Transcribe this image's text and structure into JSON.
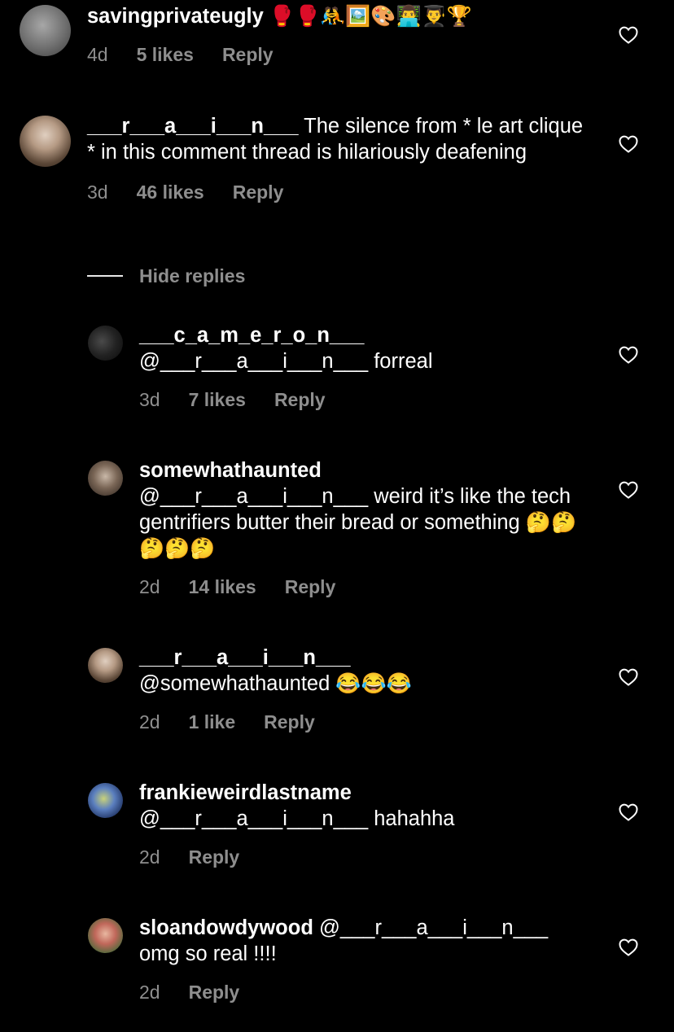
{
  "comments": [
    {
      "username": "savingprivateugly",
      "username_emoji": "🥊🥊🤼🖼️🎨👨‍💻👨‍🎓🏆",
      "text": "",
      "time": "4d",
      "likes": "5 likes",
      "reply_label": "Reply",
      "avatar_colors": [
        "#9a9a9a",
        "#5a5a5a"
      ]
    },
    {
      "username": "___r___a___i___n___",
      "text": "The silence from * le art clique * in this comment thread is hilariously deafening",
      "time": "3d",
      "likes": "46 likes",
      "reply_label": "Reply",
      "avatar_colors": [
        "#c8b9a4",
        "#6b5a4a"
      ]
    }
  ],
  "hide_replies_label": "Hide replies",
  "replies": [
    {
      "username": "___c_a_m_e_r_o_n___",
      "text": "@___r___a___i___n___ forreal",
      "emoji": "",
      "time": "3d",
      "likes": "7 likes",
      "reply_label": "Reply",
      "avatar_colors": [
        "#3a3a3a",
        "#0c0c0c"
      ]
    },
    {
      "username": "somewhathaunted",
      "text": "@___r___a___i___n___ weird it’s like the tech gentrifiers butter their bread or something",
      "emoji": "🤔🤔🤔🤔🤔",
      "time": "2d",
      "likes": "14 likes",
      "reply_label": "Reply",
      "avatar_colors": [
        "#a8988a",
        "#3b2f28"
      ]
    },
    {
      "username": "___r___a___i___n___",
      "text": "@somewhathaunted",
      "emoji": "😂😂😂",
      "time": "2d",
      "likes": "1 like",
      "reply_label": "Reply",
      "avatar_colors": [
        "#c8b9a4",
        "#6b5a4a"
      ]
    },
    {
      "username": "frankieweirdlastname",
      "text": "@___r___a___i___n___ hahahha",
      "emoji": "",
      "time": "2d",
      "likes": "",
      "reply_label": "Reply",
      "avatar_colors": [
        "#5a7ec0",
        "#1e2f5a"
      ]
    },
    {
      "username": "sloandowdywood",
      "text": "@___r___a___i___n___ omg so real !!!!",
      "emoji": "",
      "time": "2d",
      "likes": "",
      "reply_label": "Reply",
      "avatar_colors": [
        "#c0675a",
        "#4a6a3a"
      ]
    }
  ],
  "icons": {
    "like": "heart-outline-icon"
  }
}
